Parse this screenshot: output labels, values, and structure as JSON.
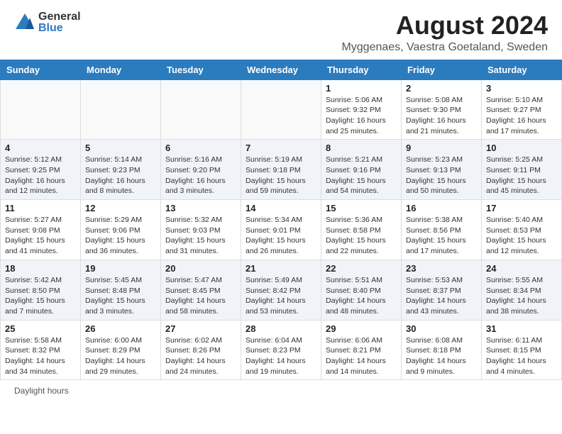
{
  "header": {
    "logo_general": "General",
    "logo_blue": "Blue",
    "title": "August 2024",
    "subtitle": "Myggenaes, Vaestra Goetaland, Sweden"
  },
  "calendar": {
    "days_of_week": [
      "Sunday",
      "Monday",
      "Tuesday",
      "Wednesday",
      "Thursday",
      "Friday",
      "Saturday"
    ],
    "weeks": [
      [
        {
          "day": "",
          "info": ""
        },
        {
          "day": "",
          "info": ""
        },
        {
          "day": "",
          "info": ""
        },
        {
          "day": "",
          "info": ""
        },
        {
          "day": "1",
          "info": "Sunrise: 5:06 AM\nSunset: 9:32 PM\nDaylight: 16 hours and 25 minutes."
        },
        {
          "day": "2",
          "info": "Sunrise: 5:08 AM\nSunset: 9:30 PM\nDaylight: 16 hours and 21 minutes."
        },
        {
          "day": "3",
          "info": "Sunrise: 5:10 AM\nSunset: 9:27 PM\nDaylight: 16 hours and 17 minutes."
        }
      ],
      [
        {
          "day": "4",
          "info": "Sunrise: 5:12 AM\nSunset: 9:25 PM\nDaylight: 16 hours and 12 minutes."
        },
        {
          "day": "5",
          "info": "Sunrise: 5:14 AM\nSunset: 9:23 PM\nDaylight: 16 hours and 8 minutes."
        },
        {
          "day": "6",
          "info": "Sunrise: 5:16 AM\nSunset: 9:20 PM\nDaylight: 16 hours and 3 minutes."
        },
        {
          "day": "7",
          "info": "Sunrise: 5:19 AM\nSunset: 9:18 PM\nDaylight: 15 hours and 59 minutes."
        },
        {
          "day": "8",
          "info": "Sunrise: 5:21 AM\nSunset: 9:16 PM\nDaylight: 15 hours and 54 minutes."
        },
        {
          "day": "9",
          "info": "Sunrise: 5:23 AM\nSunset: 9:13 PM\nDaylight: 15 hours and 50 minutes."
        },
        {
          "day": "10",
          "info": "Sunrise: 5:25 AM\nSunset: 9:11 PM\nDaylight: 15 hours and 45 minutes."
        }
      ],
      [
        {
          "day": "11",
          "info": "Sunrise: 5:27 AM\nSunset: 9:08 PM\nDaylight: 15 hours and 41 minutes."
        },
        {
          "day": "12",
          "info": "Sunrise: 5:29 AM\nSunset: 9:06 PM\nDaylight: 15 hours and 36 minutes."
        },
        {
          "day": "13",
          "info": "Sunrise: 5:32 AM\nSunset: 9:03 PM\nDaylight: 15 hours and 31 minutes."
        },
        {
          "day": "14",
          "info": "Sunrise: 5:34 AM\nSunset: 9:01 PM\nDaylight: 15 hours and 26 minutes."
        },
        {
          "day": "15",
          "info": "Sunrise: 5:36 AM\nSunset: 8:58 PM\nDaylight: 15 hours and 22 minutes."
        },
        {
          "day": "16",
          "info": "Sunrise: 5:38 AM\nSunset: 8:56 PM\nDaylight: 15 hours and 17 minutes."
        },
        {
          "day": "17",
          "info": "Sunrise: 5:40 AM\nSunset: 8:53 PM\nDaylight: 15 hours and 12 minutes."
        }
      ],
      [
        {
          "day": "18",
          "info": "Sunrise: 5:42 AM\nSunset: 8:50 PM\nDaylight: 15 hours and 7 minutes."
        },
        {
          "day": "19",
          "info": "Sunrise: 5:45 AM\nSunset: 8:48 PM\nDaylight: 15 hours and 3 minutes."
        },
        {
          "day": "20",
          "info": "Sunrise: 5:47 AM\nSunset: 8:45 PM\nDaylight: 14 hours and 58 minutes."
        },
        {
          "day": "21",
          "info": "Sunrise: 5:49 AM\nSunset: 8:42 PM\nDaylight: 14 hours and 53 minutes."
        },
        {
          "day": "22",
          "info": "Sunrise: 5:51 AM\nSunset: 8:40 PM\nDaylight: 14 hours and 48 minutes."
        },
        {
          "day": "23",
          "info": "Sunrise: 5:53 AM\nSunset: 8:37 PM\nDaylight: 14 hours and 43 minutes."
        },
        {
          "day": "24",
          "info": "Sunrise: 5:55 AM\nSunset: 8:34 PM\nDaylight: 14 hours and 38 minutes."
        }
      ],
      [
        {
          "day": "25",
          "info": "Sunrise: 5:58 AM\nSunset: 8:32 PM\nDaylight: 14 hours and 34 minutes."
        },
        {
          "day": "26",
          "info": "Sunrise: 6:00 AM\nSunset: 8:29 PM\nDaylight: 14 hours and 29 minutes."
        },
        {
          "day": "27",
          "info": "Sunrise: 6:02 AM\nSunset: 8:26 PM\nDaylight: 14 hours and 24 minutes."
        },
        {
          "day": "28",
          "info": "Sunrise: 6:04 AM\nSunset: 8:23 PM\nDaylight: 14 hours and 19 minutes."
        },
        {
          "day": "29",
          "info": "Sunrise: 6:06 AM\nSunset: 8:21 PM\nDaylight: 14 hours and 14 minutes."
        },
        {
          "day": "30",
          "info": "Sunrise: 6:08 AM\nSunset: 8:18 PM\nDaylight: 14 hours and 9 minutes."
        },
        {
          "day": "31",
          "info": "Sunrise: 6:11 AM\nSunset: 8:15 PM\nDaylight: 14 hours and 4 minutes."
        }
      ]
    ]
  },
  "footer": {
    "daylight_label": "Daylight hours"
  }
}
